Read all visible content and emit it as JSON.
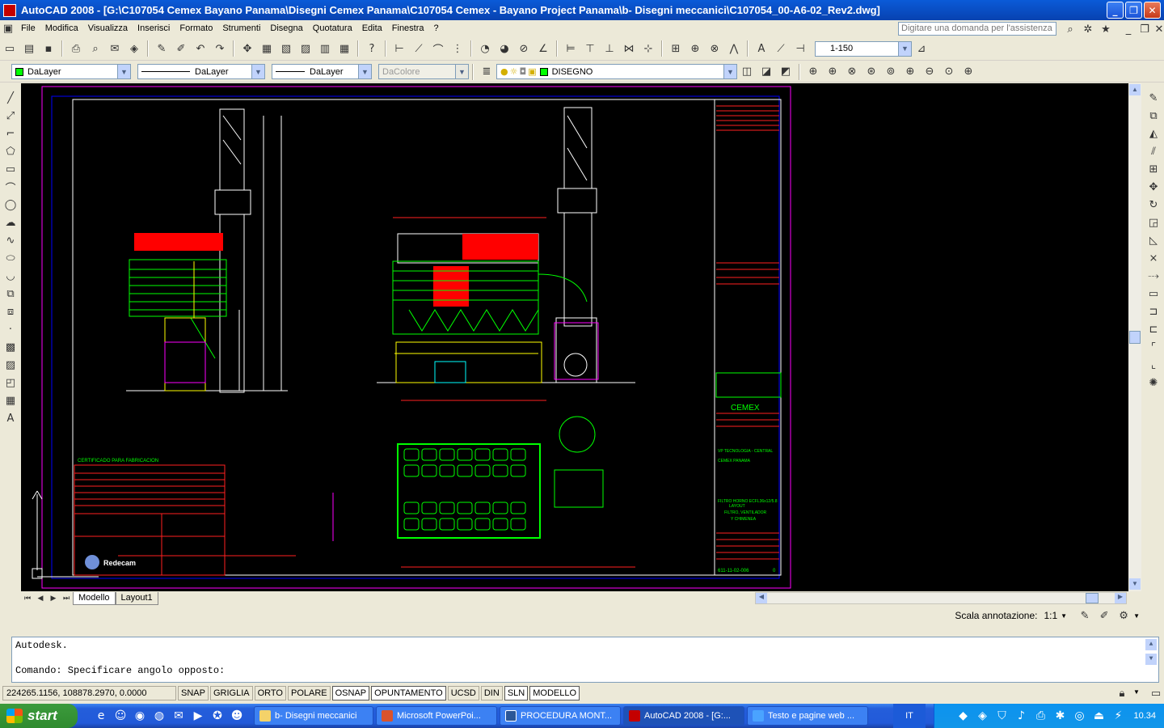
{
  "window": {
    "title": "AutoCAD 2008 - [G:\\C107054 Cemex Bayano Panama\\Disegni Cemex Panama\\C107054 Cemex - Bayano Project Panama\\b- Disegni meccanici\\C107054_00-A6-02_Rev2.dwg]"
  },
  "menu": {
    "items": [
      "File",
      "Modifica",
      "Visualizza",
      "Inserisci",
      "Formato",
      "Strumenti",
      "Disegna",
      "Quotatura",
      "Edita",
      "Finestra",
      "?"
    ],
    "help_placeholder": "Digitare una domanda per l'assistenza"
  },
  "toolbar": {
    "scale_value": "1-150",
    "layer_color": "DaLayer",
    "linetype": "DaLayer",
    "lineweight": "DaLayer",
    "plot_style": "DaColore",
    "current_layer": "DISEGNO"
  },
  "layout_tabs": [
    "Modello",
    "Layout1"
  ],
  "annotation": {
    "label": "Scala annotazione:",
    "value": "1:1"
  },
  "command": {
    "line1": "Autodesk.",
    "line2": "Comando: Specificare angolo opposto:"
  },
  "status": {
    "coordinates": "224265.1156, 108878.2970, 0.0000",
    "buttons": [
      {
        "label": "SNAP",
        "on": false
      },
      {
        "label": "GRIGLIA",
        "on": false
      },
      {
        "label": "ORTO",
        "on": false
      },
      {
        "label": "POLARE",
        "on": false
      },
      {
        "label": "OSNAP",
        "on": true
      },
      {
        "label": "OPUNTAMENTO",
        "on": true
      },
      {
        "label": "UCSD",
        "on": false
      },
      {
        "label": "DIN",
        "on": false
      },
      {
        "label": "SLN",
        "on": true
      },
      {
        "label": "MODELLO",
        "on": true
      }
    ]
  },
  "drawing": {
    "cert_label": "CERTIFICADO PARA FABRICACION",
    "brand": "CEMEX",
    "company": "Redecam",
    "sheet_number": "611-11-02-006",
    "revision": "0",
    "title_lines": [
      "FILTRO HORNO ECFL36x12/5.8",
      "LAYOUT",
      "FILTRO, VENTILADOR",
      "Y CHIMENEA"
    ],
    "project": "CEMEX PANAMA",
    "dept": "VP TECNOLOGIA - CENTRAL"
  },
  "taskbar": {
    "start_label": "start",
    "tasks": [
      {
        "label": "b- Disegni meccanici",
        "active": false
      },
      {
        "label": "Microsoft PowerPoi...",
        "active": false
      },
      {
        "label": "PROCEDURA MONT...",
        "active": false
      },
      {
        "label": "AutoCAD 2008 - [G:...",
        "active": true
      },
      {
        "label": "Testo e pagine web ...",
        "active": false
      }
    ],
    "language": "IT",
    "clock": "10.34"
  }
}
